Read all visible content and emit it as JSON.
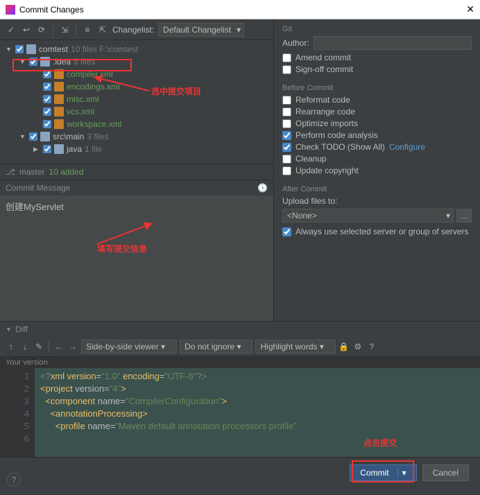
{
  "title": "Commit Changes",
  "toolbar": {
    "changelist_label": "Changelist:",
    "changelist_value": "Default Changelist"
  },
  "tree": {
    "root": {
      "name": "comtest",
      "meta": "10 files  F:\\comtest"
    },
    "idea": {
      "name": ".idea",
      "meta": "5 files"
    },
    "files": {
      "compiler": "compiler.xml",
      "encodings": "encodings.xml",
      "misc": "misc.xml",
      "vcs": "vcs.xml",
      "workspace": "workspace.xml"
    },
    "srcmain": {
      "name": "src\\main",
      "meta": "3 files"
    },
    "java": {
      "name": "java",
      "meta": "1 file"
    }
  },
  "branch": {
    "name": "master",
    "added": "10 added"
  },
  "commit_msg_label": "Commit Message",
  "commit_msg_value": "创建MyServlet",
  "git_label": "Git",
  "author_label": "Author:",
  "amend": "Amend commit",
  "signoff": "Sign-off commit",
  "before_label": "Before Commit",
  "before": {
    "reformat": "Reformat code",
    "rearrange": "Rearrange code",
    "optimize": "Optimize imports",
    "analysis": "Perform code analysis",
    "todo": "Check TODO (Show All)",
    "configure": "Configure",
    "cleanup": "Cleanup",
    "copyright": "Update copyright"
  },
  "after_label": "After Commit",
  "upload_label": "Upload files to:",
  "upload_value": "<None>",
  "always_use": "Always use selected server or group of servers",
  "diff_label": "Diff",
  "diff_toolbar": {
    "viewer": "Side-by-side viewer",
    "ignore": "Do not ignore",
    "highlight": "Highlight words"
  },
  "your_version": "Your version",
  "code": {
    "l1a": "<?",
    "l1b": "xml version",
    "l1c": "=",
    "l1d": "\"1.0\"",
    "l1e": " encoding",
    "l1f": "=",
    "l1g": "\"UTF-8\"",
    "l1h": "?>",
    "l2a": "<",
    "l2b": "project ",
    "l2c": "version",
    "l2d": "=",
    "l2e": "\"4\"",
    "l2f": ">",
    "l3a": "  <",
    "l3b": "component ",
    "l3c": "name",
    "l3d": "=",
    "l3e": "\"CompilerConfiguration\"",
    "l3f": ">",
    "l4a": "    <",
    "l4b": "annotationProcessing",
    "l4c": ">",
    "l5a": "      <",
    "l5b": "profile ",
    "l5c": "name",
    "l5d": "=",
    "l5e": "\"Maven default annotation processors profile\""
  },
  "annotations": {
    "select_project": "选中提交项目",
    "fill_info": "填写提交信息",
    "click_commit": "点击提交"
  },
  "buttons": {
    "commit": "Commit",
    "cancel": "Cancel"
  }
}
